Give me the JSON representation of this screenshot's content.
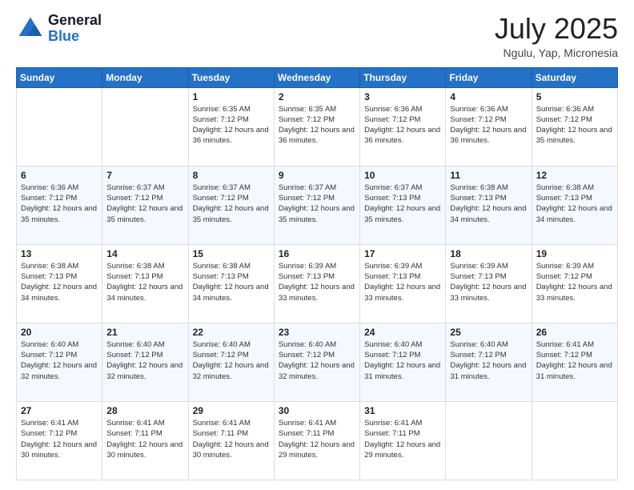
{
  "header": {
    "logo_line1": "General",
    "logo_line2": "Blue",
    "month_year": "July 2025",
    "location": "Ngulu, Yap, Micronesia"
  },
  "days_of_week": [
    "Sunday",
    "Monday",
    "Tuesday",
    "Wednesday",
    "Thursday",
    "Friday",
    "Saturday"
  ],
  "weeks": [
    [
      {
        "day": "",
        "info": ""
      },
      {
        "day": "",
        "info": ""
      },
      {
        "day": "1",
        "info": "Sunrise: 6:35 AM\nSunset: 7:12 PM\nDaylight: 12 hours and 36 minutes."
      },
      {
        "day": "2",
        "info": "Sunrise: 6:35 AM\nSunset: 7:12 PM\nDaylight: 12 hours and 36 minutes."
      },
      {
        "day": "3",
        "info": "Sunrise: 6:36 AM\nSunset: 7:12 PM\nDaylight: 12 hours and 36 minutes."
      },
      {
        "day": "4",
        "info": "Sunrise: 6:36 AM\nSunset: 7:12 PM\nDaylight: 12 hours and 36 minutes."
      },
      {
        "day": "5",
        "info": "Sunrise: 6:36 AM\nSunset: 7:12 PM\nDaylight: 12 hours and 35 minutes."
      }
    ],
    [
      {
        "day": "6",
        "info": "Sunrise: 6:36 AM\nSunset: 7:12 PM\nDaylight: 12 hours and 35 minutes."
      },
      {
        "day": "7",
        "info": "Sunrise: 6:37 AM\nSunset: 7:12 PM\nDaylight: 12 hours and 35 minutes."
      },
      {
        "day": "8",
        "info": "Sunrise: 6:37 AM\nSunset: 7:12 PM\nDaylight: 12 hours and 35 minutes."
      },
      {
        "day": "9",
        "info": "Sunrise: 6:37 AM\nSunset: 7:12 PM\nDaylight: 12 hours and 35 minutes."
      },
      {
        "day": "10",
        "info": "Sunrise: 6:37 AM\nSunset: 7:13 PM\nDaylight: 12 hours and 35 minutes."
      },
      {
        "day": "11",
        "info": "Sunrise: 6:38 AM\nSunset: 7:13 PM\nDaylight: 12 hours and 34 minutes."
      },
      {
        "day": "12",
        "info": "Sunrise: 6:38 AM\nSunset: 7:13 PM\nDaylight: 12 hours and 34 minutes."
      }
    ],
    [
      {
        "day": "13",
        "info": "Sunrise: 6:38 AM\nSunset: 7:13 PM\nDaylight: 12 hours and 34 minutes."
      },
      {
        "day": "14",
        "info": "Sunrise: 6:38 AM\nSunset: 7:13 PM\nDaylight: 12 hours and 34 minutes."
      },
      {
        "day": "15",
        "info": "Sunrise: 6:38 AM\nSunset: 7:13 PM\nDaylight: 12 hours and 34 minutes."
      },
      {
        "day": "16",
        "info": "Sunrise: 6:39 AM\nSunset: 7:13 PM\nDaylight: 12 hours and 33 minutes."
      },
      {
        "day": "17",
        "info": "Sunrise: 6:39 AM\nSunset: 7:13 PM\nDaylight: 12 hours and 33 minutes."
      },
      {
        "day": "18",
        "info": "Sunrise: 6:39 AM\nSunset: 7:13 PM\nDaylight: 12 hours and 33 minutes."
      },
      {
        "day": "19",
        "info": "Sunrise: 6:39 AM\nSunset: 7:12 PM\nDaylight: 12 hours and 33 minutes."
      }
    ],
    [
      {
        "day": "20",
        "info": "Sunrise: 6:40 AM\nSunset: 7:12 PM\nDaylight: 12 hours and 32 minutes."
      },
      {
        "day": "21",
        "info": "Sunrise: 6:40 AM\nSunset: 7:12 PM\nDaylight: 12 hours and 32 minutes."
      },
      {
        "day": "22",
        "info": "Sunrise: 6:40 AM\nSunset: 7:12 PM\nDaylight: 12 hours and 32 minutes."
      },
      {
        "day": "23",
        "info": "Sunrise: 6:40 AM\nSunset: 7:12 PM\nDaylight: 12 hours and 32 minutes."
      },
      {
        "day": "24",
        "info": "Sunrise: 6:40 AM\nSunset: 7:12 PM\nDaylight: 12 hours and 31 minutes."
      },
      {
        "day": "25",
        "info": "Sunrise: 6:40 AM\nSunset: 7:12 PM\nDaylight: 12 hours and 31 minutes."
      },
      {
        "day": "26",
        "info": "Sunrise: 6:41 AM\nSunset: 7:12 PM\nDaylight: 12 hours and 31 minutes."
      }
    ],
    [
      {
        "day": "27",
        "info": "Sunrise: 6:41 AM\nSunset: 7:12 PM\nDaylight: 12 hours and 30 minutes."
      },
      {
        "day": "28",
        "info": "Sunrise: 6:41 AM\nSunset: 7:11 PM\nDaylight: 12 hours and 30 minutes."
      },
      {
        "day": "29",
        "info": "Sunrise: 6:41 AM\nSunset: 7:11 PM\nDaylight: 12 hours and 30 minutes."
      },
      {
        "day": "30",
        "info": "Sunrise: 6:41 AM\nSunset: 7:11 PM\nDaylight: 12 hours and 29 minutes."
      },
      {
        "day": "31",
        "info": "Sunrise: 6:41 AM\nSunset: 7:11 PM\nDaylight: 12 hours and 29 minutes."
      },
      {
        "day": "",
        "info": ""
      },
      {
        "day": "",
        "info": ""
      }
    ]
  ]
}
